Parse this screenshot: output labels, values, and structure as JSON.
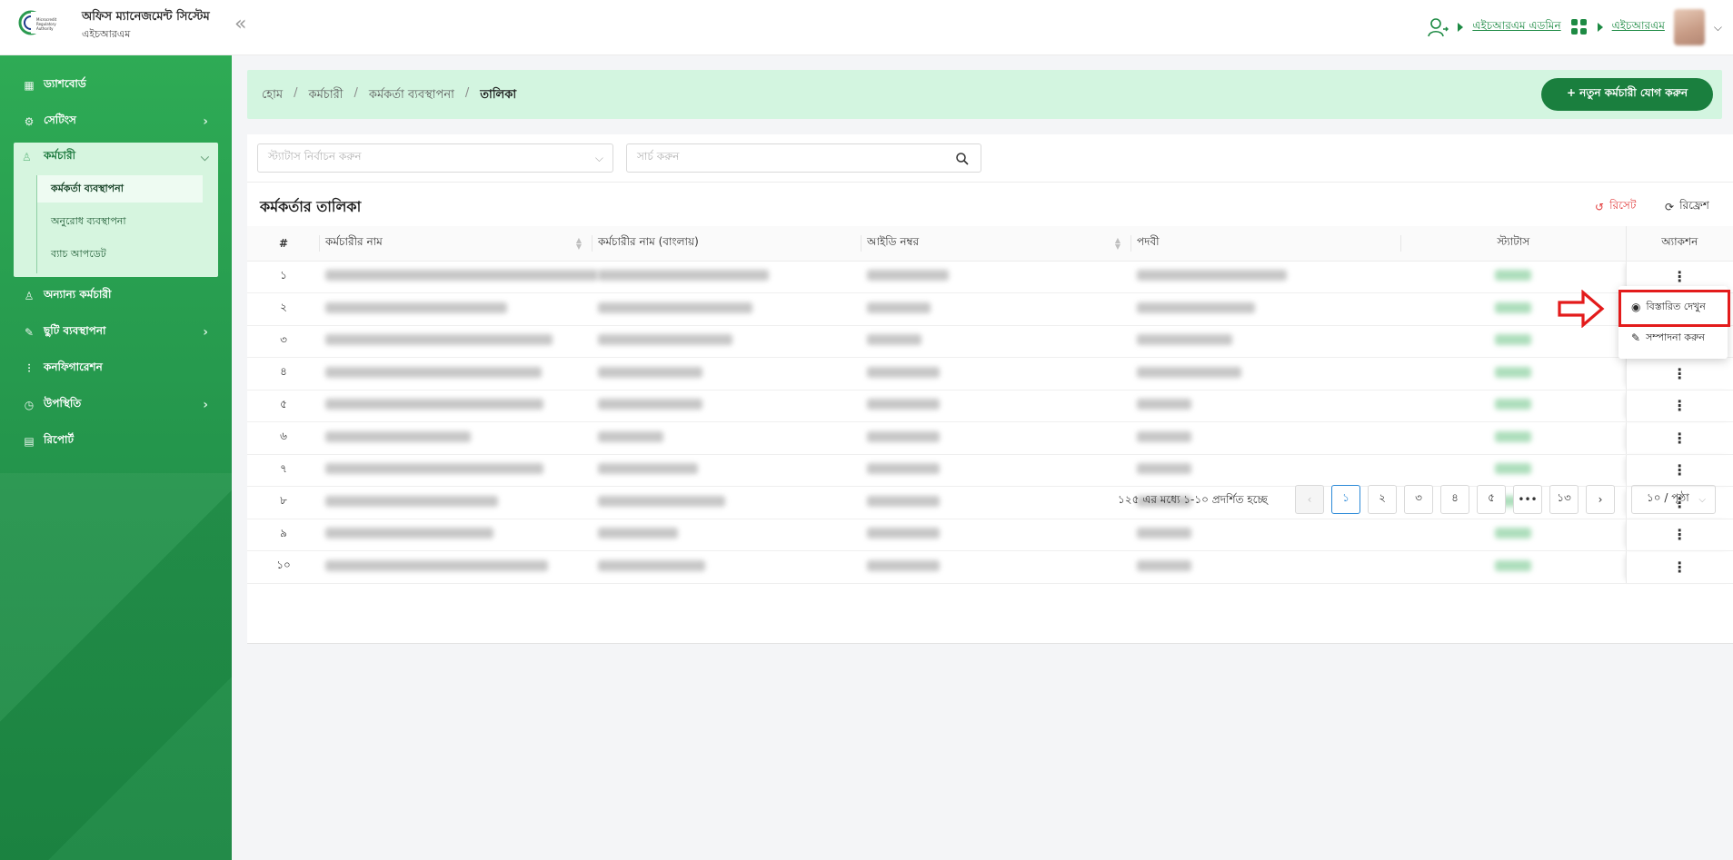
{
  "header": {
    "title": "অফিস ম্যানেজমেন্ট সিস্টেম",
    "subtitle": "এইচআরএম",
    "logo_text": "Microcredit Regulatory Authority",
    "user_role": "এইচআরএম এডমিন",
    "module": "এইচআরএম"
  },
  "sidebar": {
    "items": [
      {
        "label": "ড্যাশবোর্ড",
        "icon": "dashboard-icon"
      },
      {
        "label": "সেটিংস",
        "icon": "gear-icon"
      },
      {
        "label": "কর্মচারী",
        "icon": "user-icon"
      },
      {
        "label": "অন্যান্য কর্মচারী",
        "icon": "users-icon"
      },
      {
        "label": "ছুটি ব্যবস্থাপনা",
        "icon": "leaf-icon"
      },
      {
        "label": "কনফিগারেশন",
        "icon": "sliders-icon"
      },
      {
        "label": "উপস্থিতি",
        "icon": "clock-icon"
      },
      {
        "label": "রিপোর্ট",
        "icon": "file-icon"
      }
    ],
    "employee_sub": [
      "কর্মকর্তা ব্যবস্থাপনা",
      "অনুরোধ ব্যবস্থাপনা",
      "ব্যাচ আপডেট"
    ]
  },
  "breadcrumb": [
    "হোম",
    "কর্মচারী",
    "কর্মকর্তা ব্যবস্থাপনা",
    "তালিকা"
  ],
  "add_button": "+ নতুন কর্মচারী যোগ করুন",
  "filters": {
    "status_placeholder": "স্ট্যাটাস নির্বাচন করুন",
    "search_placeholder": "সার্চ করুন"
  },
  "table": {
    "title": "কর্মকর্তার তালিকা",
    "reset_label": "রিসেট",
    "refresh_label": "রিফ্রেশ",
    "columns": [
      "#",
      "কর্মচারীর নাম",
      "কর্মচারীর নাম (বাংলায়)",
      "আইডি নম্বর",
      "পদবী",
      "স্ট্যাটাস",
      "অ্যাকশন"
    ],
    "row_numbers": [
      "১",
      "২",
      "৩",
      "৪",
      "৫",
      "৬",
      "৭",
      "৮",
      "৯",
      "১০"
    ]
  },
  "action_menu": {
    "view_label": "বিস্তারিত দেখুন",
    "edit_label": "সম্পাদনা করুন"
  },
  "pagination": {
    "info": "১২৫ এর মধ্যে ১-১০ প্রদর্শিত হচ্ছে",
    "pages": [
      "১",
      "২",
      "৩",
      "৪",
      "৫",
      "•••",
      "১৩"
    ],
    "page_size": "১০ / পৃষ্ঠা"
  },
  "colors": {
    "brand_green": "#22914a",
    "highlight_red": "#e31b1b",
    "breadcrumb_bg": "#d3f5e0"
  }
}
